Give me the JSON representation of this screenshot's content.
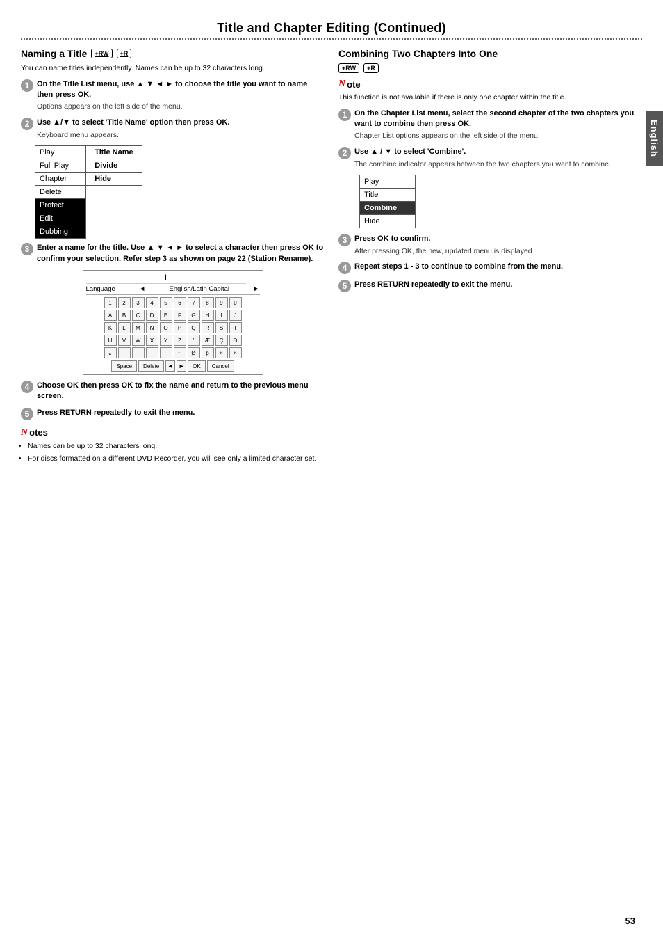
{
  "page": {
    "title": "Title and Chapter Editing (Continued)",
    "page_number": "53",
    "sidebar_label": "English"
  },
  "left_section": {
    "heading": "Naming a Title",
    "badges": [
      "+RW",
      "+R"
    ],
    "intro": "You can name titles independently. Names can be up to 32 characters long.",
    "steps": [
      {
        "num": "1",
        "text": "On the Title List menu, use ▲ ▼ ◄ ► to choose the title you want to name then press OK.",
        "sub": "Options appears on the left side of the menu."
      },
      {
        "num": "2",
        "text": "Use ▲/▼ to select 'Title Name' option then press OK.",
        "sub": "Keyboard menu appears."
      },
      {
        "num": "3",
        "text": "Enter a name for the title. Use ▲ ▼ ◄ ► to select a character then press OK to confirm your selection. Refer step 3 as shown on page 22 (Station Rename)."
      },
      {
        "num": "4",
        "text": "Choose OK then press OK to fix the name and return to the previous menu screen."
      },
      {
        "num": "5",
        "text": "Press RETURN repeatedly to exit the menu."
      }
    ],
    "main_menu_items": [
      "Play",
      "Full Play",
      "Chapter",
      "Delete"
    ],
    "popup_items": [
      "Title Name",
      "Divide",
      "Hide"
    ],
    "popup_row_labels": [
      "Protect",
      "Edit",
      "Dubbing"
    ],
    "keyboard": {
      "language_label": "Language",
      "charset_label": "English/Latin Capital",
      "cursor_text": "I",
      "rows": [
        [
          "1",
          "2",
          "3",
          "4",
          "5",
          "6",
          "7",
          "8",
          "9",
          "0"
        ],
        [
          "A",
          "B",
          "C",
          "D",
          "E",
          "F",
          "G",
          "H",
          "I",
          "J"
        ],
        [
          "K",
          "L",
          "M",
          "N",
          "O",
          "P",
          "Q",
          "R",
          "S",
          "T"
        ],
        [
          "U",
          "V",
          "W",
          "X",
          "Y",
          "Z",
          "'",
          "Æ",
          "Ç",
          "Ð"
        ],
        [
          "¿",
          "¡",
          "·",
          "–",
          "—",
          "~",
          "Ø",
          "þ",
          "×",
          "×"
        ]
      ],
      "footer_buttons": [
        "Space",
        "Delete",
        "◄",
        "►",
        "OK",
        "Cancel"
      ]
    },
    "notes": {
      "heading": "Notes",
      "bullets": [
        "Names can be up to 32 characters long.",
        "For discs formatted on a different DVD Recorder, you will see only a limited character set."
      ]
    }
  },
  "right_section": {
    "heading": "Combining Two Chapters Into One",
    "badges": [
      "+RW",
      "+R"
    ],
    "note_text": "This function is not available if there is only one chapter within the title.",
    "steps": [
      {
        "num": "1",
        "text": "On the Chapter List menu, select the second chapter of the two chapters you want to combine then press OK.",
        "sub": "Chapter List options appears on the left side of the menu."
      },
      {
        "num": "2",
        "text": "Use ▲ / ▼ to select 'Combine'.",
        "sub": "The combine indicator appears between the two chapters you want to combine."
      },
      {
        "num": "3",
        "text": "Press OK to confirm.",
        "sub": "After pressing OK, the new, updated menu is displayed."
      },
      {
        "num": "4",
        "text": "Repeat steps 1 - 3 to continue to combine from the menu."
      },
      {
        "num": "5",
        "text": "Press RETURN repeatedly to exit the menu."
      }
    ],
    "combine_menu_items": [
      "Play",
      "Title",
      "Combine",
      "Hide"
    ],
    "combine_highlighted": "Combine"
  }
}
